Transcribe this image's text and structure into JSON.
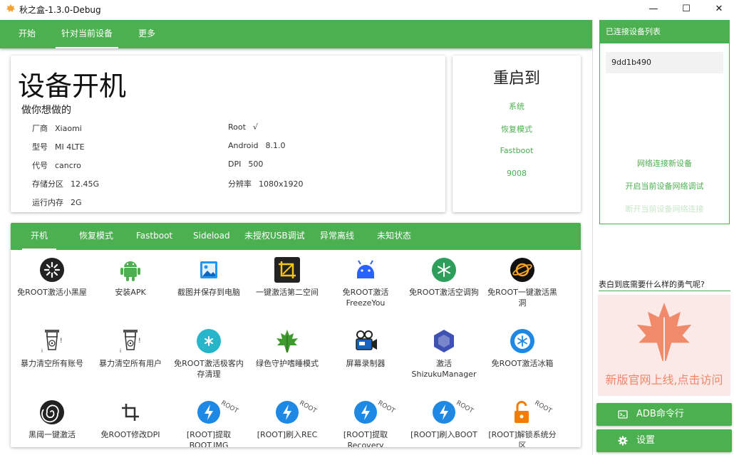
{
  "window": {
    "title": "秋之盒-1.3.0-Debug",
    "minimize": "—",
    "maximize": "☐",
    "close": "✕"
  },
  "top_tabs": [
    "开始",
    "针对当前设备",
    "更多"
  ],
  "device_card": {
    "title": "设备开机",
    "subtitle": "做你想做的",
    "left": [
      {
        "label": "厂商",
        "value": "Xiaomi"
      },
      {
        "label": "型号",
        "value": "MI 4LTE"
      },
      {
        "label": "代号",
        "value": "cancro"
      },
      {
        "label": "存储分区",
        "value": "12.45G"
      },
      {
        "label": "运行内存",
        "value": "2G"
      }
    ],
    "right": [
      {
        "label": "Root",
        "value": "√"
      },
      {
        "label": "Android",
        "value": "8.1.0"
      },
      {
        "label": "DPI",
        "value": "500"
      },
      {
        "label": "分辨率",
        "value": "1080x1920"
      }
    ]
  },
  "reboot": {
    "title": "重启到",
    "options": [
      "系统",
      "恢复模式",
      "Fastboot",
      "9008"
    ]
  },
  "mode_tabs": [
    "开机",
    "恢复模式",
    "Fastboot",
    "Sideload",
    "未授权USB调试",
    "异常离线",
    "未知状态"
  ],
  "tiles": [
    {
      "label": "免ROOT激活小黑屋",
      "icon": "black-hole-icon"
    },
    {
      "label": "安装APK",
      "icon": "android-icon"
    },
    {
      "label": "截图并保存到电脑",
      "icon": "screenshot-icon"
    },
    {
      "label": "一键激活第二空间",
      "icon": "crop-icon"
    },
    {
      "label": "免ROOT激活FreezeYou",
      "icon": "freezeyou-icon"
    },
    {
      "label": "免ROOT激活空调狗",
      "icon": "snowflake-icon"
    },
    {
      "label": "免ROOT一键激活黑洞",
      "icon": "blackhole-planet-icon"
    },
    {
      "label": "暴力清空所有账号",
      "icon": "bomb-icon"
    },
    {
      "label": "暴力清空所有用户",
      "icon": "bomb-icon"
    },
    {
      "label": "免ROOT激活极客内存清理",
      "icon": "geek-memory-icon"
    },
    {
      "label": "绿色守护嗜睡模式",
      "icon": "maple-leaf-icon"
    },
    {
      "label": "屏幕录制器",
      "icon": "video-camera-icon"
    },
    {
      "label": "激活ShizukuManager",
      "icon": "shizuku-icon"
    },
    {
      "label": "免ROOT激活冰箱",
      "icon": "ice-box-icon"
    },
    {
      "label": "黑阈一键激活",
      "icon": "spiral-icon"
    },
    {
      "label": "免ROOT修改DPI",
      "icon": "crop-dpi-icon"
    },
    {
      "label": "[ROOT]提取BOOT.IMG",
      "icon": "root-flash-icon",
      "badge": "ROOT"
    },
    {
      "label": "[ROOT]刷入REC",
      "icon": "root-flash-icon",
      "badge": "ROOT"
    },
    {
      "label": "[ROOT]提取Recovery",
      "icon": "root-flash-icon",
      "badge": "ROOT"
    },
    {
      "label": "[ROOT]刷入BOOT",
      "icon": "root-flash-icon",
      "badge": "ROOT"
    },
    {
      "label": "[ROOT]解锁系统分区",
      "icon": "unlock-icon",
      "badge": "ROOT"
    }
  ],
  "devices_panel": {
    "header": "已连接设备列表",
    "devices": [
      "9dd1b490"
    ],
    "links": [
      "网络连接新设备",
      "开启当前设备网络调试",
      "断开当前设备网络连接"
    ]
  },
  "question": "表白到底需要什么样的勇气呢?",
  "ad": {
    "text": "新版官网上线,点击访问"
  },
  "buttons": {
    "adb": "ADB命令行",
    "settings": "设置"
  },
  "colors": {
    "accent": "#4caf50",
    "ad_text": "#f0876b"
  }
}
